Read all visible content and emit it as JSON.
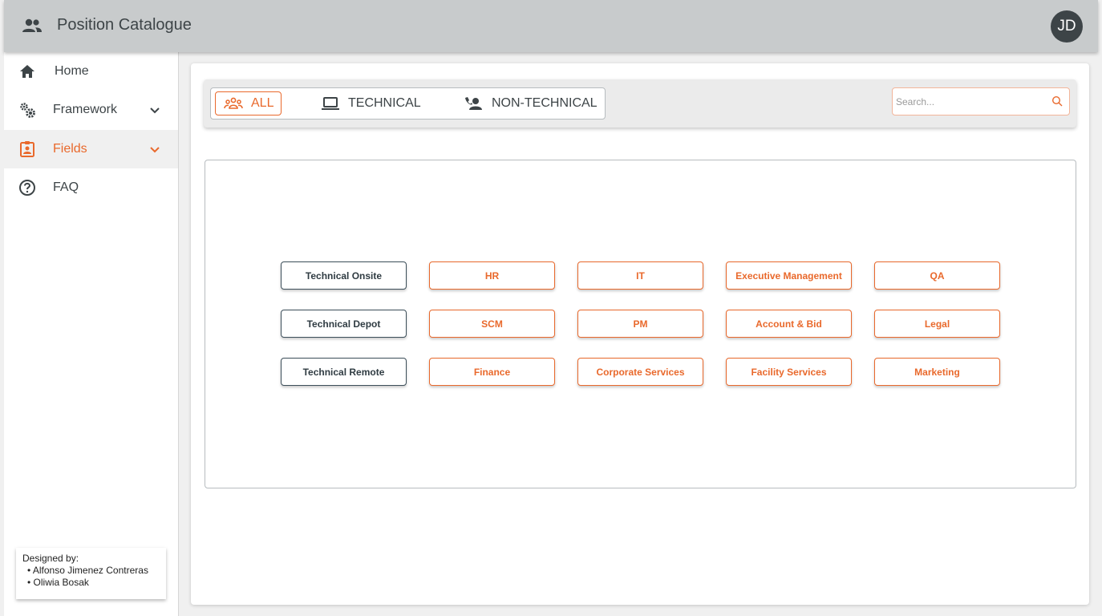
{
  "app": {
    "title": "Position Catalogue",
    "avatar_initials": "JD"
  },
  "colors": {
    "accent": "#e9692c",
    "header_bg": "#c8cbcc",
    "text_dark": "#3d4447"
  },
  "sidebar": {
    "items": [
      {
        "label": "Home",
        "icon": "home-icon"
      },
      {
        "label": "Framework",
        "icon": "gears-icon"
      },
      {
        "label": "Fields",
        "icon": "badge-icon"
      },
      {
        "label": "FAQ",
        "icon": "help-circle-icon"
      }
    ],
    "active_item": "Fields",
    "credits": {
      "heading": "Designed by:",
      "names": [
        "Alfonso Jimenez Contreras",
        "Oliwia Bosak"
      ]
    }
  },
  "filters": {
    "all": "ALL",
    "technical": "TECHNICAL",
    "non_technical": "NON-TECHNICAL",
    "selected": "ALL"
  },
  "search": {
    "placeholder": "Search..."
  },
  "fields": {
    "technical": [
      "Technical Onsite",
      "Technical Depot",
      "Technical Remote"
    ],
    "non_technical": [
      [
        "HR",
        "IT",
        "Executive Management",
        "QA"
      ],
      [
        "SCM",
        "PM",
        "Account & Bid",
        "Legal"
      ],
      [
        "Finance",
        "Corporate Services",
        "Facility Services",
        "Marketing"
      ]
    ]
  }
}
